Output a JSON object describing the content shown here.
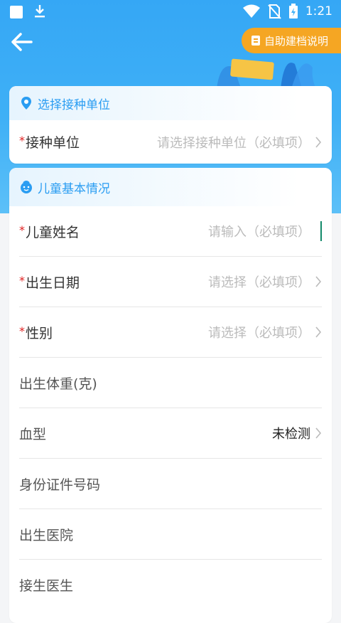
{
  "status_bar": {
    "time": "1:21"
  },
  "header": {
    "help_label": "自助建档说明"
  },
  "unit_card": {
    "title": "选择接种单位",
    "rows": [
      {
        "label": "接种单位",
        "required": "*",
        "placeholder": "请选择接种单位（必填项）"
      }
    ]
  },
  "child_card": {
    "title": "儿童基本情况",
    "rows": [
      {
        "label": "儿童姓名",
        "required": "*",
        "placeholder": "请输入（必填项）"
      },
      {
        "label": "出生日期",
        "required": "*",
        "placeholder": "请选择（必填项）"
      },
      {
        "label": "性别",
        "required": "*",
        "placeholder": "请选择（必填项）"
      },
      {
        "label": "出生体重(克)"
      },
      {
        "label": "血型",
        "value": "未检测"
      },
      {
        "label": "身份证件号码"
      },
      {
        "label": "出生医院"
      },
      {
        "label": "接生医生"
      }
    ]
  },
  "colors": {
    "primary": "#35a7f5",
    "accent": "#f5a623",
    "required": "#e02020",
    "cursor": "#128a6a"
  }
}
